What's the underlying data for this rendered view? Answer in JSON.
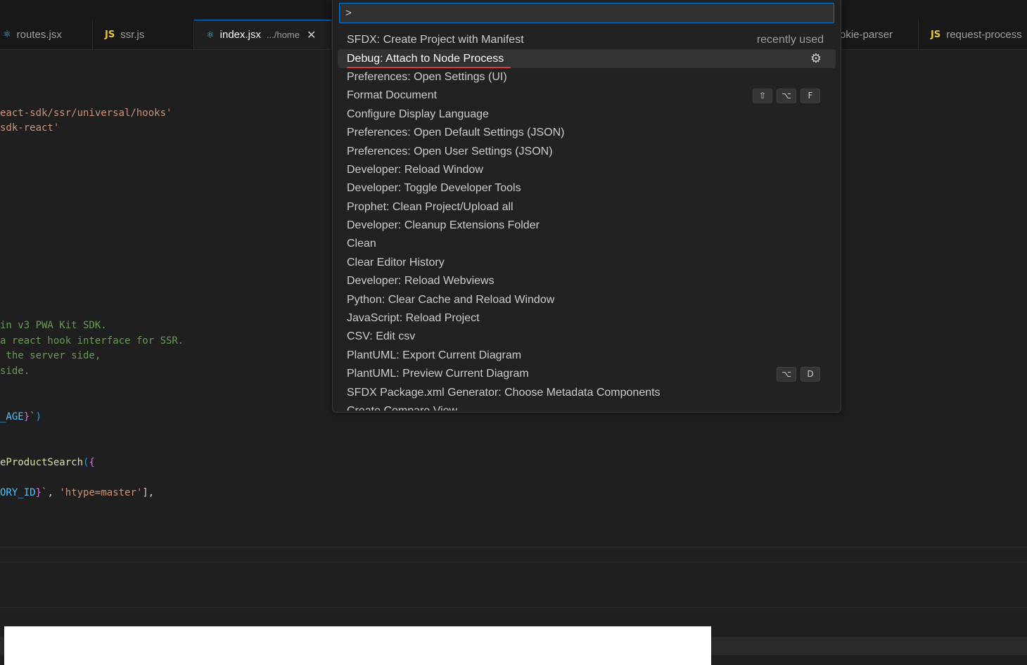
{
  "tabs": [
    {
      "label": "routes.jsx",
      "icon": "react-icon"
    },
    {
      "label": "ssr.js",
      "icon": "js-icon"
    },
    {
      "label": "index.jsx",
      "path": ".../home",
      "icon": "react-icon",
      "active": true
    },
    {
      "label": "okie-parser"
    },
    {
      "label": "request-process",
      "icon": "js-icon"
    }
  ],
  "icons": {
    "react": "⚛",
    "js": "JS",
    "close": "✕",
    "gear": "⚙"
  },
  "code": {
    "l1": "eact-sdk/ssr/universal/hooks'",
    "l2": "sdk-react'",
    "c1": "in v3 PWA Kit SDK.",
    "c2": "a react hook interface for SSR.",
    "c3": " the server side,",
    "c4": "side.",
    "t1a": "_AGE",
    "t1b": "}",
    "t1c": "`",
    "t1d": ")",
    "f1": "eProductSearch",
    "f1b": "(",
    "f1c": "{",
    "r1a": "ORY_ID",
    "r1b": "}",
    "r1c": "`",
    "r1d": ", ",
    "r1e": "'htype=master'",
    "r1f": "],"
  },
  "palette": {
    "input_value": ">",
    "recently_used": "recently used",
    "items": [
      {
        "label": "SFDX: Create Project with Manifest"
      },
      {
        "label": "Debug: Attach to Node Process"
      },
      {
        "label": "Preferences: Open Settings (UI)"
      },
      {
        "label": "Format Document",
        "keys": [
          "⇧",
          "⌥",
          "F"
        ]
      },
      {
        "label": "Configure Display Language"
      },
      {
        "label": "Preferences: Open Default Settings (JSON)"
      },
      {
        "label": "Preferences: Open User Settings (JSON)"
      },
      {
        "label": "Developer: Reload Window"
      },
      {
        "label": "Developer: Toggle Developer Tools"
      },
      {
        "label": "Prophet: Clean Project/Upload all"
      },
      {
        "label": "Developer: Cleanup Extensions Folder"
      },
      {
        "label": "Clean"
      },
      {
        "label": "Clear Editor History"
      },
      {
        "label": "Developer: Reload Webviews"
      },
      {
        "label": "Python: Clear Cache and Reload Window"
      },
      {
        "label": "JavaScript: Reload Project"
      },
      {
        "label": "CSV: Edit csv"
      },
      {
        "label": "PlantUML: Export Current Diagram"
      },
      {
        "label": "PlantUML: Preview Current Diagram",
        "keys": [
          "⌥",
          "D"
        ]
      },
      {
        "label": "SFDX Package.xml Generator: Choose Metadata Components"
      },
      {
        "label": "Create Compare View"
      }
    ]
  }
}
